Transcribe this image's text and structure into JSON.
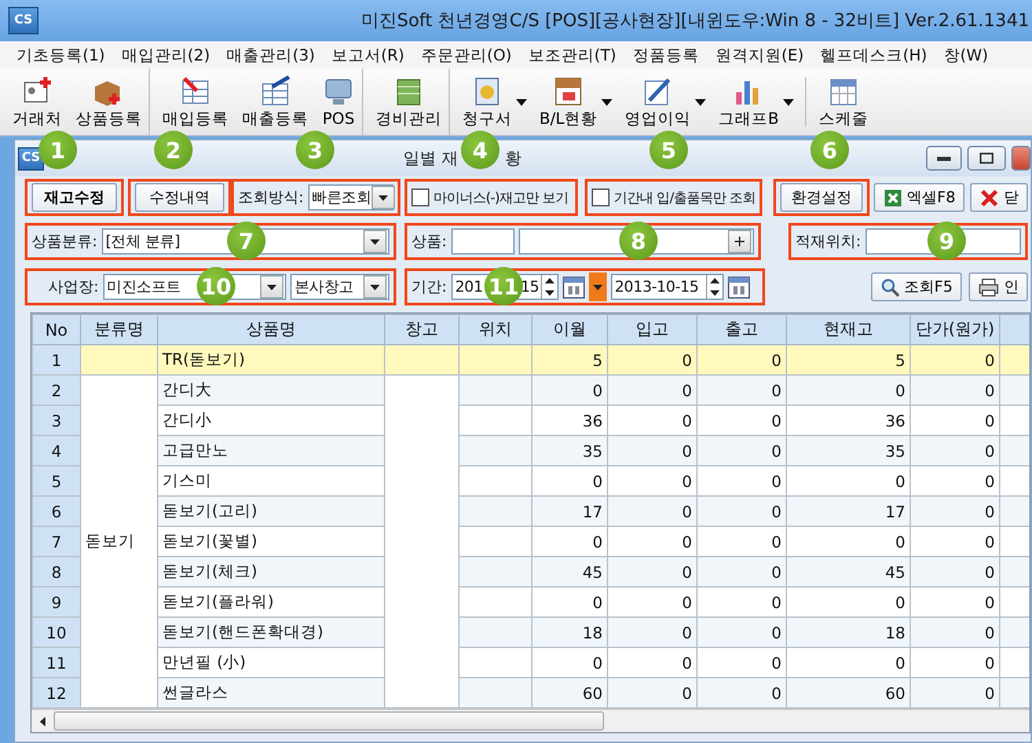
{
  "app": {
    "logo": "CS",
    "title": "미진Soft 천년경영C/S [POS][공사현장][내윈도우:Win 8 - 32비트] Ver.2.61.1341"
  },
  "menu": [
    "기초등록(1)",
    "매입관리(2)",
    "매출관리(3)",
    "보고서(R)",
    "주문관리(O)",
    "보조관리(T)",
    "정품등록",
    "원격지원(E)",
    "헬프데스크(H)",
    "창(W)"
  ],
  "toolbar": [
    {
      "label": "거래처",
      "dropdown": false,
      "separator_after": false
    },
    {
      "label": "상품등록",
      "dropdown": false,
      "separator_after": true
    },
    {
      "label": "매입등록",
      "dropdown": false,
      "separator_after": false
    },
    {
      "label": "매출등록",
      "dropdown": false,
      "separator_after": false
    },
    {
      "label": "POS",
      "dropdown": false,
      "separator_after": true
    },
    {
      "label": "경비관리",
      "dropdown": false,
      "separator_after": true
    },
    {
      "label": "청구서",
      "dropdown": true,
      "separator_after": false
    },
    {
      "label": "B/L현황",
      "dropdown": true,
      "separator_after": false
    },
    {
      "label": "영업이익",
      "dropdown": true,
      "separator_after": false
    },
    {
      "label": "그래프B",
      "dropdown": true,
      "separator_after": true
    },
    {
      "label": "스케줄",
      "dropdown": false,
      "separator_after": false
    }
  ],
  "window": {
    "logo": "CS",
    "title_parts": [
      "일별 재",
      "황"
    ]
  },
  "controls": {
    "edit_stock_button": "재고수정",
    "edit_history_button": "수정내역",
    "query_mode": {
      "label": "조회방식:",
      "value": "빠른조회"
    },
    "minus_only": {
      "label": "마이너스(-)재고만 보기",
      "checked": false
    },
    "period_only": {
      "label": "기간내 입/출품목만 조회",
      "checked": false
    },
    "settings_button": "환경설정",
    "excel_button": "엑셀F8",
    "close_button": "닫",
    "category": {
      "label": "상품분류:",
      "value": "[전체 분류]"
    },
    "product": {
      "label": "상품:"
    },
    "location": {
      "label": "적재위치:"
    },
    "site": {
      "label": "사업장:",
      "value": "미진소프트",
      "warehouse": "본사창고"
    },
    "period": {
      "label": "기간:",
      "from_parts": [
        "201",
        "15"
      ],
      "to": "2013-10-15"
    },
    "search_button": "조회F5",
    "print_button": "인"
  },
  "badges": [
    "1",
    "2",
    "3",
    "4",
    "5",
    "6",
    "7",
    "8",
    "9",
    "10",
    "11"
  ],
  "table": {
    "columns": [
      "No",
      "분류명",
      "상품명",
      "창고",
      "위치",
      "이월",
      "입고",
      "출고",
      "현재고",
      "단가(원가)"
    ],
    "merged_category": "돋보기",
    "rows": [
      {
        "no": "1",
        "product": "TR(돋보기)",
        "values": [
          "5",
          "0",
          "0",
          "5",
          "0"
        ],
        "selected": true
      },
      {
        "no": "2",
        "product": "간디大",
        "values": [
          "0",
          "0",
          "0",
          "0",
          "0"
        ],
        "selected": false
      },
      {
        "no": "3",
        "product": "간디小",
        "values": [
          "36",
          "0",
          "0",
          "36",
          "0"
        ],
        "selected": false
      },
      {
        "no": "4",
        "product": "고급만노",
        "values": [
          "35",
          "0",
          "0",
          "35",
          "0"
        ],
        "selected": false
      },
      {
        "no": "5",
        "product": "기스미",
        "values": [
          "0",
          "0",
          "0",
          "0",
          "0"
        ],
        "selected": false
      },
      {
        "no": "6",
        "product": "돋보기(고리)",
        "values": [
          "17",
          "0",
          "0",
          "17",
          "0"
        ],
        "selected": false
      },
      {
        "no": "7",
        "product": "돋보기(꽃별)",
        "values": [
          "0",
          "0",
          "0",
          "0",
          "0"
        ],
        "selected": false
      },
      {
        "no": "8",
        "product": "돋보기(체크)",
        "values": [
          "45",
          "0",
          "0",
          "45",
          "0"
        ],
        "selected": false
      },
      {
        "no": "9",
        "product": "돋보기(플라워)",
        "values": [
          "0",
          "0",
          "0",
          "0",
          "0"
        ],
        "selected": false
      },
      {
        "no": "10",
        "product": "돋보기(핸드폰확대경)",
        "values": [
          "18",
          "0",
          "0",
          "18",
          "0"
        ],
        "selected": false
      },
      {
        "no": "11",
        "product": "만년필 (小)",
        "values": [
          "0",
          "0",
          "0",
          "0",
          "0"
        ],
        "selected": false
      },
      {
        "no": "12",
        "product": "썬글라스",
        "values": [
          "60",
          "0",
          "0",
          "60",
          "0"
        ],
        "selected": false
      }
    ]
  }
}
